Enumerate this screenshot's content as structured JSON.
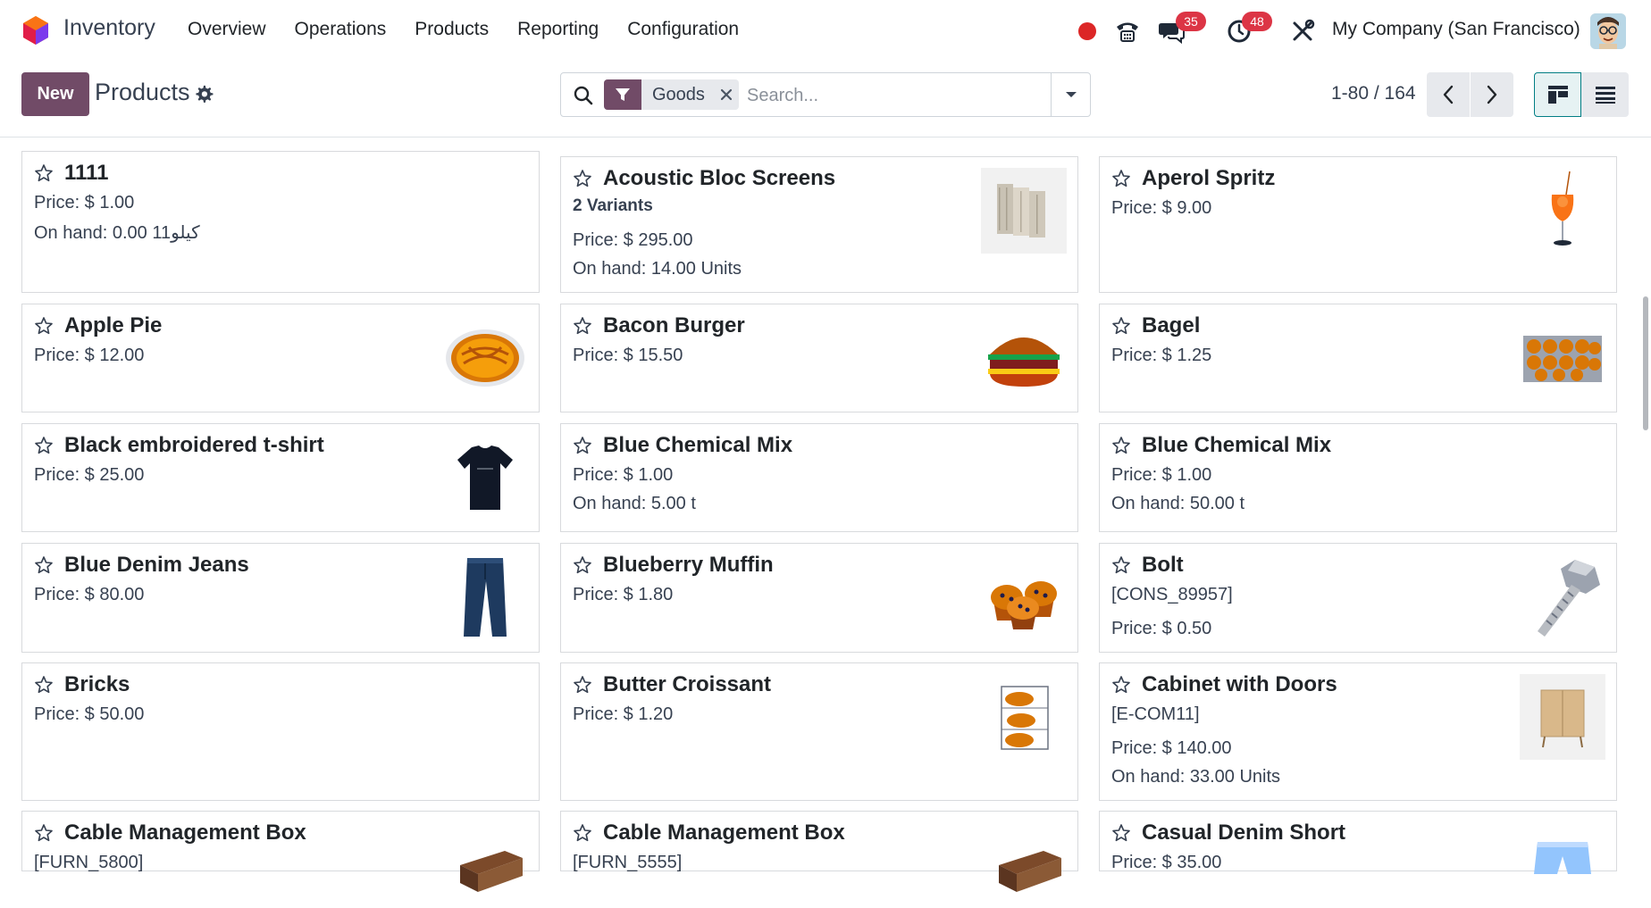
{
  "app": {
    "name": "Inventory"
  },
  "menu": [
    "Overview",
    "Operations",
    "Products",
    "Reporting",
    "Configuration"
  ],
  "tray": {
    "messages_count": "35",
    "activities_count": "48",
    "company": "My Company (San Francisco)"
  },
  "control": {
    "new_label": "New",
    "breadcrumb": "Products",
    "facet": "Goods",
    "search_placeholder": "Search...",
    "pager": "1-80 / 164"
  },
  "products": [
    {
      "name": "1111",
      "lines": [
        "Price: $ 1.00",
        "On hand: 0.00 11كيلو"
      ],
      "image": ""
    },
    {
      "name": "Acoustic Bloc Screens",
      "variants": "2 Variants",
      "lines": [
        "Price: $ 295.00",
        "On hand: 14.00 Units"
      ],
      "image": "screen-image"
    },
    {
      "name": "Aperol Spritz",
      "lines": [
        "Price: $ 9.00"
      ],
      "image": "cocktail-image"
    },
    {
      "name": "Apple Pie",
      "lines": [
        "Price: $ 12.00"
      ],
      "image": "pie-image"
    },
    {
      "name": "Bacon Burger",
      "lines": [
        "Price: $ 15.50"
      ],
      "image": "burger-image"
    },
    {
      "name": "Bagel",
      "lines": [
        "Price: $ 1.25"
      ],
      "image": "bagel-image"
    },
    {
      "name": "Black embroidered t-shirt",
      "lines": [
        "Price: $ 25.00"
      ],
      "image": "tshirt-image"
    },
    {
      "name": "Blue Chemical Mix",
      "lines": [
        "Price: $ 1.00",
        "On hand: 5.00 t"
      ],
      "image": ""
    },
    {
      "name": "Blue Chemical Mix",
      "lines": [
        "Price: $ 1.00",
        "On hand: 50.00 t"
      ],
      "image": ""
    },
    {
      "name": "Blue Denim Jeans",
      "lines": [
        "Price: $ 80.00"
      ],
      "image": "jeans-image"
    },
    {
      "name": "Blueberry Muffin",
      "lines": [
        "Price: $ 1.80"
      ],
      "image": "muffin-image"
    },
    {
      "name": "Bolt",
      "ref": "[CONS_89957]",
      "lines": [
        "Price: $ 0.50"
      ],
      "image": "bolt-image"
    },
    {
      "name": "Bricks",
      "lines": [
        "Price: $ 50.00"
      ],
      "image": ""
    },
    {
      "name": "Butter Croissant",
      "lines": [
        "Price: $ 1.20"
      ],
      "image": "croissant-image"
    },
    {
      "name": "Cabinet with Doors",
      "ref": "[E-COM11]",
      "lines": [
        "Price: $ 140.00",
        "On hand: 33.00 Units"
      ],
      "image": "cabinet-image"
    },
    {
      "name": "Cable Management Box",
      "ref": "[FURN_5800]",
      "lines": [],
      "image": "box-image"
    },
    {
      "name": "Cable Management Box",
      "ref": "[FURN_5555]",
      "lines": [],
      "image": "box-image"
    },
    {
      "name": "Casual Denim Short",
      "lines": [
        "Price: $ 35.00"
      ],
      "image": "shorts-image"
    }
  ]
}
